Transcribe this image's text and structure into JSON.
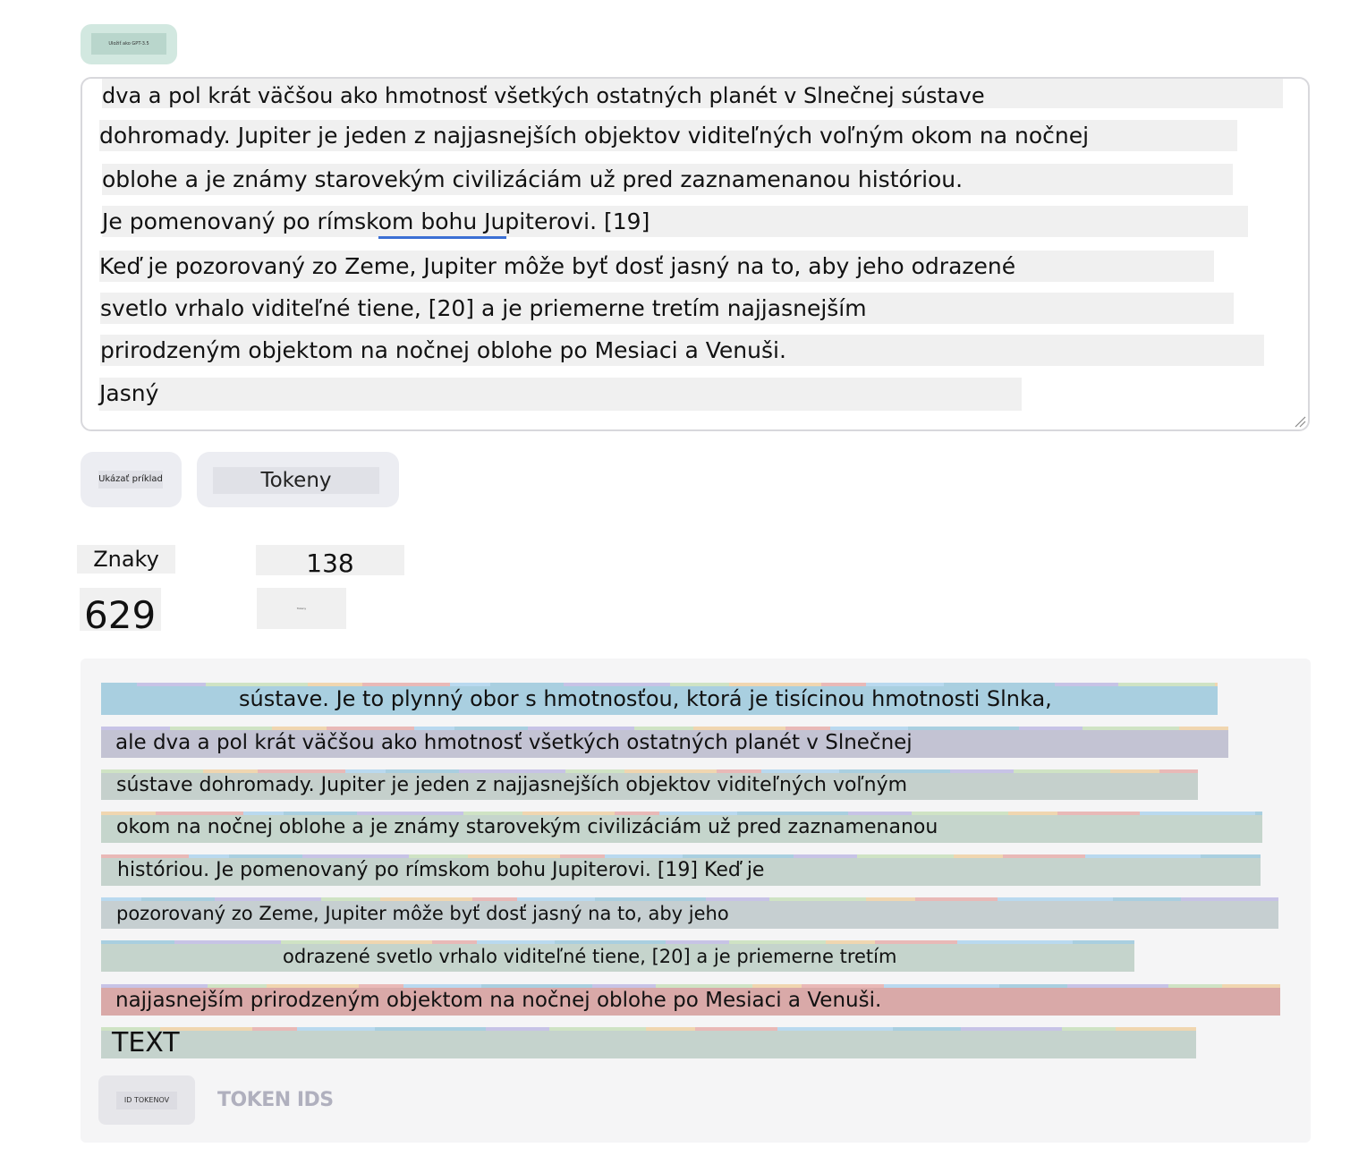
{
  "top_chip": {
    "label": "Uložiť ako GPT-3.5"
  },
  "editor": {
    "lines": [
      "dva a pol krát väčšou ako hmotnosť všetkých ostatných planét v Slnečnej sústave",
      "dohromady. Jupiter je jeden z najjasnejších objektov viditeľných voľným okom na nočnej",
      "oblohe a je známy starovekým civilizáciám už pred zaznamenanou históriou.",
      "Je pomenovaný po rímskom bohu Jupiterovi. [19]",
      "Keď je pozorovaný zo Zeme, Jupiter môže byť dosť jasný na to, aby jeho odrazené",
      "svetlo vrhalo viditeľné tiene, [20] a je priemerne tretím najjasnejším",
      "prirodzeným objektom na nočnej oblohe po Mesiaci a Venuši.",
      "Jasný"
    ]
  },
  "buttons": {
    "show_example": "Ukázať príklad",
    "tokens": "Tokeny"
  },
  "stats": {
    "chars_label": "Znaky",
    "chars_value": "629",
    "tokens_label": "Tokeny",
    "tokens_value": "138"
  },
  "token_view": {
    "rows": [
      {
        "text": "sústave. Je to plynný obor s hmotnosťou, ktorá je tisícinou hmotnosti Slnka,",
        "color": "#a9cfe0"
      },
      {
        "text": "ale dva a pol krát väčšou ako hmotnosť všetkých ostatných planét v Slnečnej",
        "color": "#c3c3d3"
      },
      {
        "text": "sústave dohromady. Jupiter je jeden z najjasnejších objektov viditeľných voľným",
        "color": "#c5d0cc"
      },
      {
        "text": "okom na nočnej oblohe a je známy starovekým civilizáciám už pred zaznamenanou",
        "color": "#c5d5cc"
      },
      {
        "text": "históriou. Je pomenovaný po rímskom bohu Jupiterovi. [19] Keď je",
        "color": "#c5d3cd"
      },
      {
        "text": "pozorovaný zo Zeme, Jupiter môže byť dosť jasný na to, aby jeho",
        "color": "#c6cfd1"
      },
      {
        "text": "odrazené svetlo vrhalo viditeľné tiene, [20] a je priemerne tretím",
        "color": "#c5d4cc"
      },
      {
        "text": "najjasnejším prirodzeným objektom na nočnej oblohe po Mesiaci a Venuši.",
        "color": "#d9a9a8"
      },
      {
        "text": "TEXT",
        "color": "#c5d3cd"
      }
    ],
    "palette": [
      "#a9cfe0",
      "#c7c3e6",
      "#cfe3c4",
      "#f0d6b0",
      "#e9b9b7",
      "#b9d9ef"
    ],
    "ids_button": "ID TOKENOV",
    "ids_label": "TOKEN IDS"
  }
}
